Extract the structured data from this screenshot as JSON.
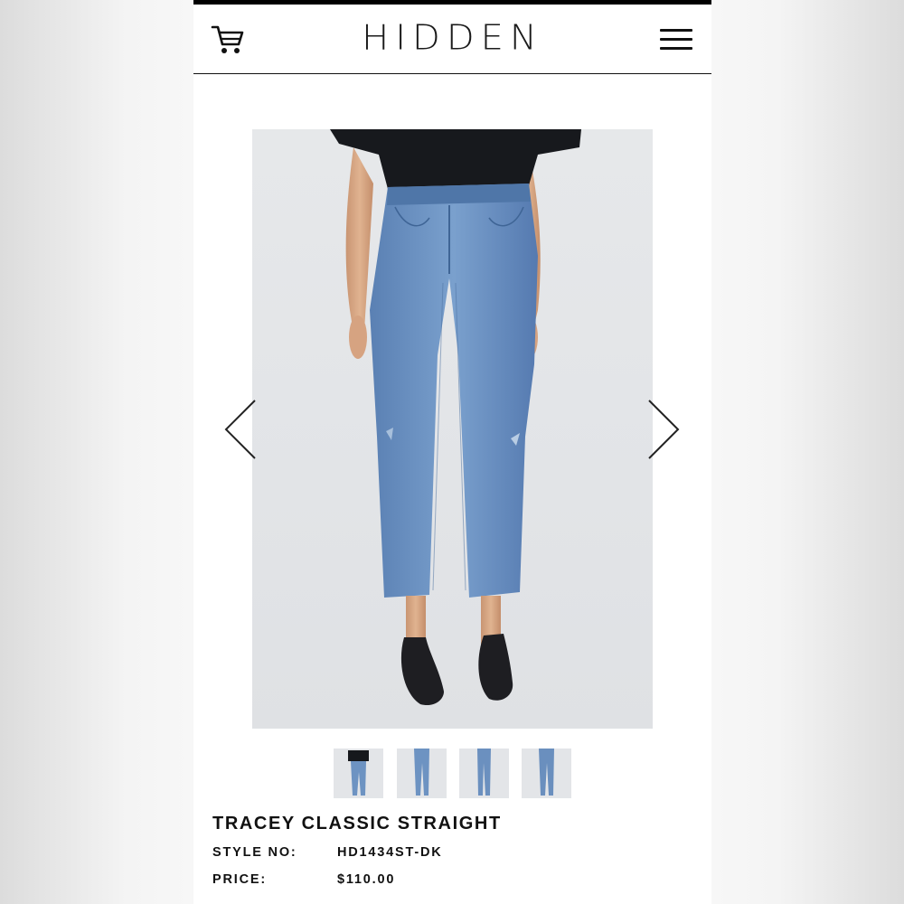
{
  "header": {
    "brand": "HIDDEN",
    "cart_icon": "shopping-cart-icon",
    "menu_icon": "hamburger-menu-icon"
  },
  "gallery": {
    "prev_icon": "chevron-left-icon",
    "next_icon": "chevron-right-icon",
    "thumbnail_count": 4,
    "selected_thumbnail": 1
  },
  "product": {
    "title": "TRACEY CLASSIC STRAIGHT",
    "style_label": "STYLE NO:",
    "style_value": "HD1434ST-DK",
    "price_label": "PRICE:",
    "price_value": "$110.00"
  },
  "colors": {
    "denim": "#6d93c2",
    "denim_dark": "#4f76a8",
    "shirt": "#16181c",
    "shoe": "#1e1e22",
    "skin": "#d8a883"
  }
}
